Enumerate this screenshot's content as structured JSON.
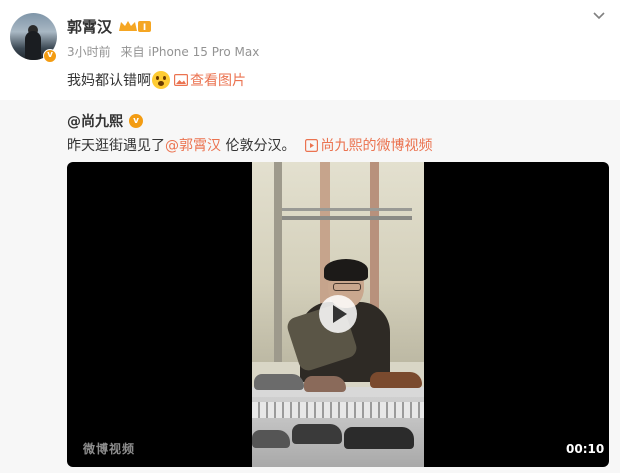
{
  "post": {
    "username": "郭霄汉",
    "level_badge": "I",
    "time": "3小时前",
    "source": "来自 iPhone 15 Pro Max",
    "text": "我妈都认错啊",
    "emoji_icon": "shocked-face-emoji",
    "view_image_label": "查看图片"
  },
  "repost": {
    "author": "@尚九熙",
    "text_before": "昨天逛街遇见了",
    "mention": "@郭霄汉",
    "text_after": " 伦敦分汉。",
    "video_link_label": "尚九熙的微博视频"
  },
  "video": {
    "duration": "00:10",
    "watermark": "微博视频"
  },
  "colors": {
    "accent": "#eb7350",
    "verified": "#f39c12",
    "muted": "#939393"
  }
}
